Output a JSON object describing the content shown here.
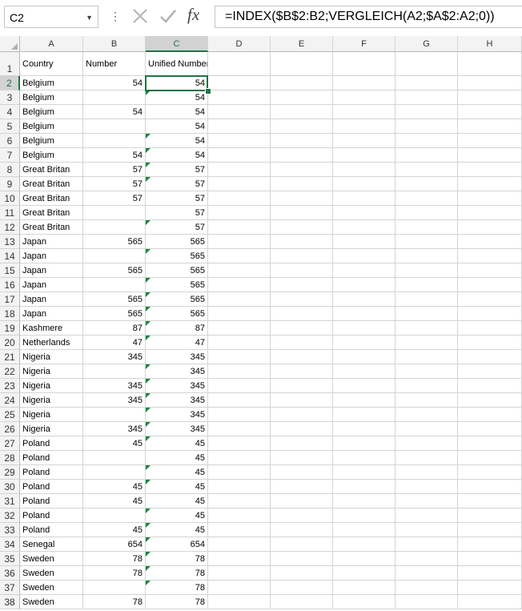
{
  "name_box": {
    "value": "C2",
    "arrow_icon": "chevron-down-icon"
  },
  "formula_bar": {
    "more_icon": "more-vertical-icon",
    "cancel_icon": "close-icon",
    "enter_icon": "check-icon",
    "fx_label": "fx",
    "formula": "=INDEX($B$2:B2;VERGLEICH(A2;$A$2:A2;0))"
  },
  "columns": [
    "A",
    "B",
    "C",
    "D",
    "E",
    "F",
    "G",
    "H"
  ],
  "selected_column": "C",
  "selected_row": 2,
  "headers": {
    "A": "Country",
    "B": "Number",
    "C": "Unified Number"
  },
  "rows": [
    {
      "num": "2",
      "a": "Belgium",
      "b": "54",
      "c": "54",
      "tri": false
    },
    {
      "num": "3",
      "a": "Belgium",
      "b": "",
      "c": "54",
      "tri": true
    },
    {
      "num": "4",
      "a": "Belgium",
      "b": "54",
      "c": "54",
      "tri": false
    },
    {
      "num": "5",
      "a": "Belgium",
      "b": "",
      "c": "54",
      "tri": false
    },
    {
      "num": "6",
      "a": "Belgium",
      "b": "",
      "c": "54",
      "tri": true
    },
    {
      "num": "7",
      "a": "Belgium",
      "b": "54",
      "c": "54",
      "tri": true
    },
    {
      "num": "8",
      "a": "Great Britan",
      "b": "57",
      "c": "57",
      "tri": true
    },
    {
      "num": "9",
      "a": "Great Britan",
      "b": "57",
      "c": "57",
      "tri": true
    },
    {
      "num": "10",
      "a": "Great Britan",
      "b": "57",
      "c": "57",
      "tri": false
    },
    {
      "num": "11",
      "a": "Great Britan",
      "b": "",
      "c": "57",
      "tri": false
    },
    {
      "num": "12",
      "a": "Great Britan",
      "b": "",
      "c": "57",
      "tri": true
    },
    {
      "num": "13",
      "a": "Japan",
      "b": "565",
      "c": "565",
      "tri": false
    },
    {
      "num": "14",
      "a": "Japan",
      "b": "",
      "c": "565",
      "tri": true
    },
    {
      "num": "15",
      "a": "Japan",
      "b": "565",
      "c": "565",
      "tri": false
    },
    {
      "num": "16",
      "a": "Japan",
      "b": "",
      "c": "565",
      "tri": true
    },
    {
      "num": "17",
      "a": "Japan",
      "b": "565",
      "c": "565",
      "tri": true
    },
    {
      "num": "18",
      "a": "Japan",
      "b": "565",
      "c": "565",
      "tri": true
    },
    {
      "num": "19",
      "a": "Kashmere",
      "b": "87",
      "c": "87",
      "tri": true
    },
    {
      "num": "20",
      "a": "Netherlands",
      "b": "47",
      "c": "47",
      "tri": true
    },
    {
      "num": "21",
      "a": "Nigeria",
      "b": "345",
      "c": "345",
      "tri": false
    },
    {
      "num": "22",
      "a": "Nigeria",
      "b": "",
      "c": "345",
      "tri": true
    },
    {
      "num": "23",
      "a": "Nigeria",
      "b": "345",
      "c": "345",
      "tri": true
    },
    {
      "num": "24",
      "a": "Nigeria",
      "b": "345",
      "c": "345",
      "tri": true
    },
    {
      "num": "25",
      "a": "Nigeria",
      "b": "",
      "c": "345",
      "tri": true
    },
    {
      "num": "26",
      "a": "Nigeria",
      "b": "345",
      "c": "345",
      "tri": true
    },
    {
      "num": "27",
      "a": "Poland",
      "b": "45",
      "c": "45",
      "tri": true
    },
    {
      "num": "28",
      "a": "Poland",
      "b": "",
      "c": "45",
      "tri": false
    },
    {
      "num": "29",
      "a": "Poland",
      "b": "",
      "c": "45",
      "tri": true
    },
    {
      "num": "30",
      "a": "Poland",
      "b": "45",
      "c": "45",
      "tri": true
    },
    {
      "num": "31",
      "a": "Poland",
      "b": "45",
      "c": "45",
      "tri": false
    },
    {
      "num": "32",
      "a": "Poland",
      "b": "",
      "c": "45",
      "tri": true
    },
    {
      "num": "33",
      "a": "Poland",
      "b": "45",
      "c": "45",
      "tri": true
    },
    {
      "num": "34",
      "a": "Senegal",
      "b": "654",
      "c": "654",
      "tri": true
    },
    {
      "num": "35",
      "a": "Sweden",
      "b": "78",
      "c": "78",
      "tri": true
    },
    {
      "num": "36",
      "a": "Sweden",
      "b": "78",
      "c": "78",
      "tri": true
    },
    {
      "num": "37",
      "a": "Sweden",
      "b": "",
      "c": "78",
      "tri": true
    },
    {
      "num": "38",
      "a": "Sweden",
      "b": "78",
      "c": "78",
      "tri": false
    }
  ]
}
